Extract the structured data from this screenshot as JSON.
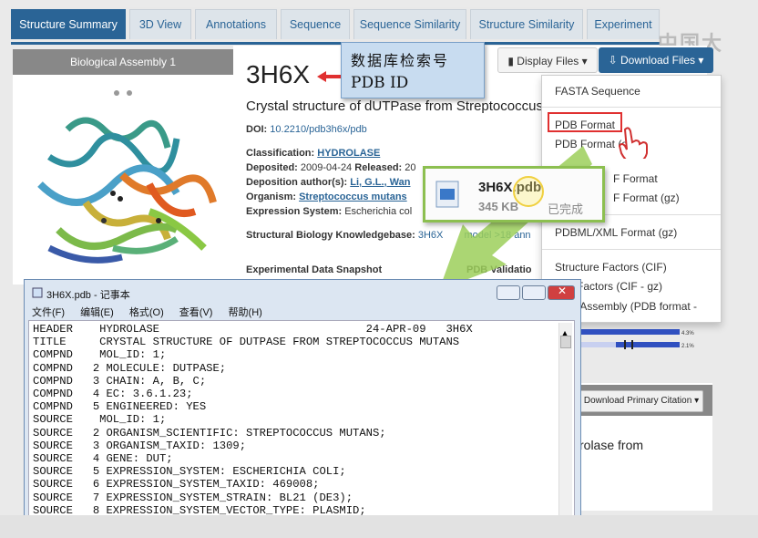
{
  "tabs": [
    "Structure Summary",
    "3D View",
    "Annotations",
    "Sequence",
    "Sequence Similarity",
    "Structure Similarity",
    "Experiment"
  ],
  "left_panel": {
    "header": "Biological Assembly 1"
  },
  "entry": {
    "id": "3H6X",
    "title": "Crystal structure of dUTPase from Streptococcus",
    "doi_label": "DOI:",
    "doi": "10.2210/pdb3h6x/pdb",
    "classification_label": "Classification:",
    "classification": "HYDROLASE",
    "deposited_label": "Deposited:",
    "deposited": "2009-04-24",
    "released_label": "Released:",
    "released": "20",
    "authors_label": "Deposition author(s):",
    "authors": "Li, G.L., Wan",
    "organism_label": "Organism:",
    "organism": "Streptococcus mutans",
    "expression_label": "Expression System:",
    "expression": "Escherichia col",
    "sbkb_label": "Structural Biology Knowledgebase:",
    "sbkb": "3H6X",
    "sbkb_rest": "model >18 ann",
    "snapshot_label": "Experimental Data Snapshot",
    "validation_label": "PDB Validatio"
  },
  "annotation": {
    "cn": "数据库检索号",
    "en": "PDB ID"
  },
  "buttons": {
    "display_files": "Display Files",
    "download_files": "Download Files"
  },
  "download_menu": {
    "items": [
      "FASTA Sequence",
      "PDB Format",
      "PDB Format (g",
      "F Format",
      "F Format (gz)",
      "PDBML/XML Format (gz)",
      "Structure Factors (CIF)",
      "ture Factors (CIF - gz)",
      "gical Assembly (PDB format -"
    ]
  },
  "right_panel": {
    "cite_button": "Download Primary Citation",
    "text": "rolase from"
  },
  "download_popup": {
    "filename": "3H6X.pdb",
    "size": "345 KB",
    "status": "已完成"
  },
  "notepad": {
    "title": "3H6X.pdb - 记事本",
    "menu": [
      "文件(F)",
      "编辑(E)",
      "格式(O)",
      "查看(V)",
      "帮助(H)"
    ],
    "lines": [
      "HEADER    HYDROLASE                               24-APR-09   3H6X",
      "TITLE     CRYSTAL STRUCTURE OF DUTPASE FROM STREPTOCOCCUS MUTANS",
      "COMPND    MOL_ID: 1;",
      "COMPND   2 MOLECULE: DUTPASE;",
      "COMPND   3 CHAIN: A, B, C;",
      "COMPND   4 EC: 3.6.1.23;",
      "COMPND   5 ENGINEERED: YES",
      "SOURCE    MOL_ID: 1;",
      "SOURCE   2 ORGANISM_SCIENTIFIC: STREPTOCOCCUS MUTANS;",
      "SOURCE   3 ORGANISM_TAXID: 1309;",
      "SOURCE   4 GENE: DUT;",
      "SOURCE   5 EXPRESSION_SYSTEM: ESCHERICHIA COLI;",
      "SOURCE   6 EXPRESSION_SYSTEM_TAXID: 469008;",
      "SOURCE   7 EXPRESSION_SYSTEM_STRAIN: BL21 (DE3);",
      "SOURCE   8 EXPRESSION_SYSTEM_VECTOR_TYPE: PLASMID;"
    ]
  },
  "watermark": "中国大",
  "colors": {
    "accent": "#2a6496",
    "highlight": "#e03030",
    "popup_border": "#8cbf50"
  }
}
